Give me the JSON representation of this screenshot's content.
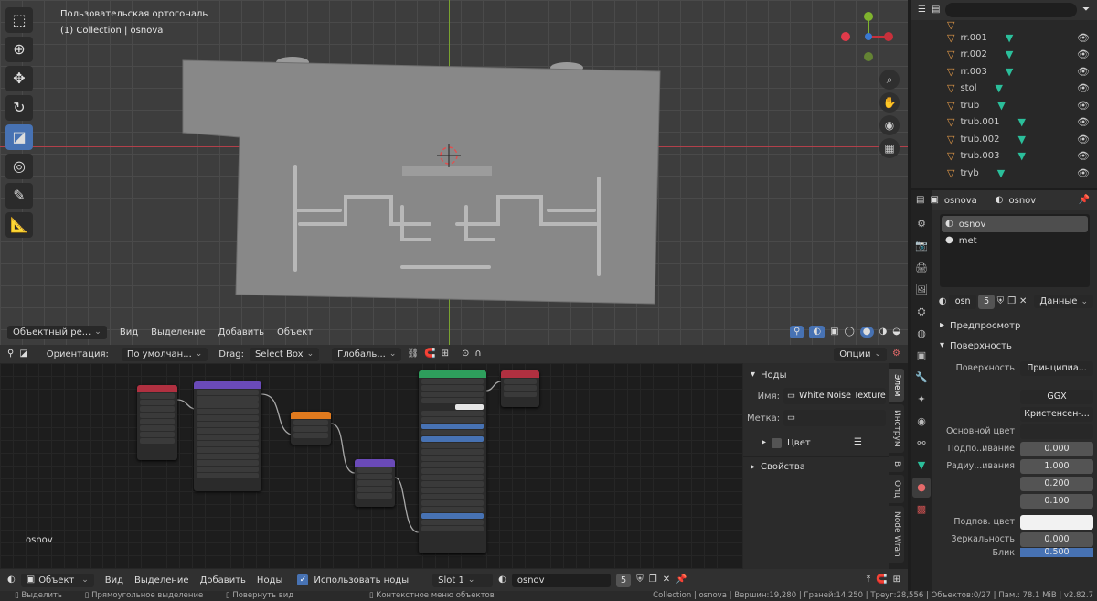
{
  "viewport": {
    "view_name": "Пользовательская ортогональ",
    "collection_line": "(1) Collection | osnova",
    "header": {
      "mode": "Объектный ре...",
      "menus": [
        "Вид",
        "Выделение",
        "Добавить",
        "Объект"
      ]
    },
    "tool_header": {
      "orientation_label": "Ориентация:",
      "orientation_value": "По умолчан...",
      "drag_label": "Drag:",
      "drag_value": "Select Box",
      "pivot_value": "Глобаль...",
      "options_label": "Опции"
    },
    "tools": [
      "select-box-icon",
      "cursor-icon",
      "move-icon",
      "rotate-icon",
      "scale-icon",
      "transform-icon",
      "annotate-icon",
      "measure-icon"
    ],
    "nav_buttons": [
      "zoom-icon",
      "hand-icon",
      "camera-icon",
      "grid-icon"
    ]
  },
  "outliner": {
    "items": [
      {
        "name": "rr.001"
      },
      {
        "name": "rr.002"
      },
      {
        "name": "rr.003"
      },
      {
        "name": "stol"
      },
      {
        "name": "trub"
      },
      {
        "name": "trub.001"
      },
      {
        "name": "trub.002"
      },
      {
        "name": "trub.003"
      },
      {
        "name": "tryb"
      }
    ]
  },
  "properties": {
    "object_name": "osnova",
    "material_name": "osnov",
    "slots": [
      "osnov",
      "met"
    ],
    "material_field": "osn",
    "users_count": "5",
    "data_dropdown": "Данные",
    "sections": {
      "preview": "Предпросмотр",
      "surface": "Поверхность"
    },
    "surface_label": "Поверхность",
    "surface_value": "Принципиа...",
    "distribution": "GGX",
    "subsurface_method": "Кристенсен-...",
    "base_color_label": "Основной цвет",
    "subsurface_label": "Подпо..ивание",
    "subsurface_value": "0.000",
    "radius_label": "Радиу...ивания",
    "radius_values": [
      "1.000",
      "0.200",
      "0.100"
    ],
    "subsurface_color_label": "Подпов. цвет",
    "specular_label": "Зеркальность",
    "specular_value": "0.000",
    "last_label": "Блик",
    "last_value": "0.500"
  },
  "node_editor": {
    "material_label": "osnov",
    "panel": {
      "title": "Ноды",
      "name_label": "Имя:",
      "name_value": "White Noise Texture",
      "label_label": "Метка:",
      "color_label": "Цвет",
      "properties_label": "Свойства"
    },
    "tabs": [
      "Элем",
      "Инструм",
      "В",
      "Опц",
      "Node Wran"
    ],
    "footer": {
      "mode": "Объект",
      "menus": [
        "Вид",
        "Выделение",
        "Добавить",
        "Ноды"
      ],
      "use_nodes_label": "Использовать ноды",
      "slot_value": "Slot 1",
      "material_value": "osnov",
      "users": "5"
    }
  },
  "statusbar": {
    "left": [
      "Выделить",
      "Прямоугольное выделение",
      "Повернуть вид",
      "Контекстное меню объектов"
    ],
    "right": "Collection | osnova | Вершин:19,280 | Граней:14,250 | Треуг:28,556 | Объектов:0/27 | Пам.: 78.1 MiB | v2.82.7"
  },
  "colors": {
    "accent": "#4772b3",
    "axis_x": "#c8303b",
    "axis_y": "#7fb32e",
    "mesh_gray": "#8a8a8a"
  }
}
